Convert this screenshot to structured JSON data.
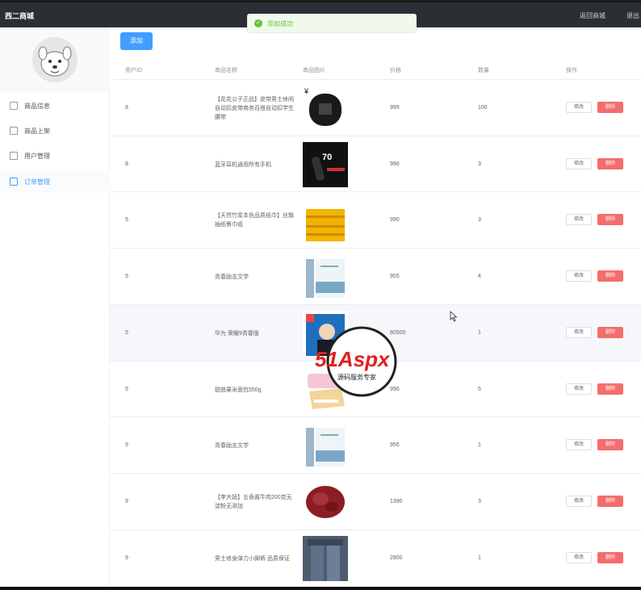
{
  "header": {
    "brand": "西二商城",
    "center_title": "",
    "nav": [
      "返回商城",
      "退出"
    ]
  },
  "toast": {
    "text": "添加成功",
    "color": "#67c23a"
  },
  "sidebar": {
    "items": [
      {
        "label": "商品信息",
        "icon": "doc-icon",
        "active": false
      },
      {
        "label": "商品上架",
        "icon": "edit-icon",
        "active": false
      },
      {
        "label": "用户管理",
        "icon": "bookmark-icon",
        "active": false
      },
      {
        "label": "订单管理",
        "icon": "bookmark-icon",
        "active": true
      }
    ]
  },
  "toolbar": {
    "add_label": "添加"
  },
  "table": {
    "columns": [
      "用户ID",
      "商品名称",
      "商品图片",
      "价格",
      "数量",
      "操作"
    ],
    "rows": [
      {
        "uid": "8",
        "name": "【花花公子正品】皮带男士休闲自动扣皮带商务百搭自动扣学生腰带",
        "price": "999",
        "qty": "100",
        "img": "belt"
      },
      {
        "uid": "8",
        "name": "蓝牙耳机通用所有手机",
        "price": "990",
        "qty": "3",
        "img": "earphone"
      },
      {
        "uid": "5",
        "name": "【天然竹浆本色品质纸巾】丝飘抽纸餐巾纸",
        "price": "990",
        "qty": "3",
        "img": "tissue"
      },
      {
        "uid": "5",
        "name": "青春励志文学",
        "price": "955",
        "qty": "4",
        "img": "books"
      },
      {
        "uid": "5",
        "name": "华为 荣耀9青春版",
        "price": "80500",
        "qty": "1",
        "img": "phone"
      },
      {
        "uid": "5",
        "name": "甜曲果米面包550g",
        "price": "990",
        "qty": "5",
        "img": "bread"
      },
      {
        "uid": "9",
        "name": "青春励志文学",
        "price": "955",
        "qty": "1",
        "img": "books"
      },
      {
        "uid": "9",
        "name": "【李大妞】五香酱牛肉200克无淀粉无添加",
        "price": "1390",
        "qty": "3",
        "img": "beef"
      },
      {
        "uid": "9",
        "name": "男士修身弹力小脚裤 品质保证",
        "price": "2800",
        "qty": "1",
        "img": "jeans"
      }
    ],
    "edit_label": "修改",
    "delete_label": "删除",
    "highlight_row": 4
  },
  "watermark": {
    "main": "51Aspx",
    "sub": "源码服务专家"
  },
  "colors": {
    "accent": "#409eff",
    "danger": "#f56c6c",
    "header_bg": "#2b2e33"
  }
}
